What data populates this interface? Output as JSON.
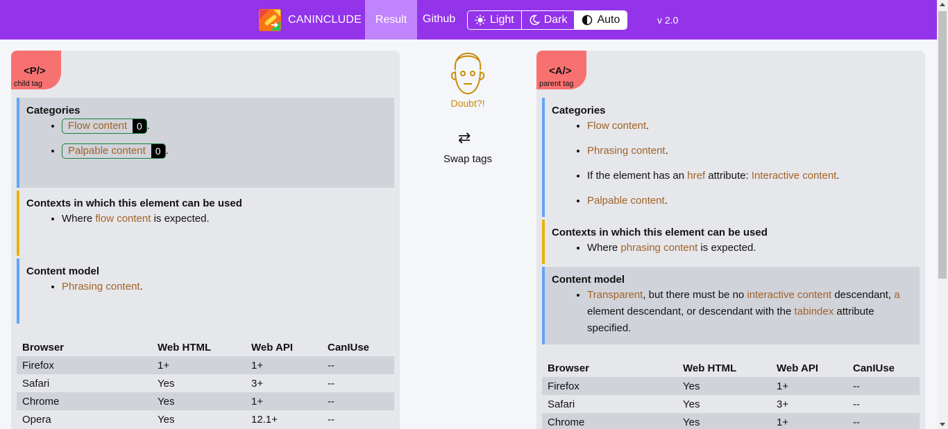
{
  "nav": {
    "brand": "CANINCLUDE",
    "result": "Result",
    "github": "Github",
    "theme": {
      "light": "Light",
      "dark": "Dark",
      "auto": "Auto",
      "active": "auto"
    },
    "version": "v 2.0",
    "colors": {
      "bar": "#9333ea",
      "active_tab": "#c084fc"
    }
  },
  "center": {
    "doubt": "Doubt?!",
    "swap": "Swap tags",
    "swap_icon": "⇄"
  },
  "left": {
    "tag": "<P/>",
    "role": "child tag",
    "categories_title": "Categories",
    "categories": [
      {
        "label": "Flow content",
        "count": "0"
      },
      {
        "label": "Palpable content",
        "count": "0"
      }
    ],
    "contexts_title": "Contexts in which this element can be used",
    "contexts": {
      "pre": "Where ",
      "link": "flow content",
      "post": " is expected."
    },
    "content_model_title": "Content model",
    "content_model": {
      "link": "Phrasing content",
      "post": "."
    },
    "table": {
      "headers": [
        "Browser",
        "Web HTML",
        "Web API",
        "CanIUse"
      ],
      "rows": [
        [
          "Firefox",
          "1+",
          "1+",
          "--"
        ],
        [
          "Safari",
          "Yes",
          "3+",
          "--"
        ],
        [
          "Chrome",
          "Yes",
          "1+",
          "--"
        ],
        [
          "Opera",
          "Yes",
          "12.1+",
          "--"
        ]
      ]
    }
  },
  "right": {
    "tag": "<A/>",
    "role": "parent tag",
    "categories_title": "Categories",
    "categories": {
      "c1": "Flow content",
      "c2": "Phrasing content",
      "c3_pre": "If the element has an ",
      "c3_attr": "href",
      "c3_mid": " attribute: ",
      "c3_link": "Interactive content",
      "c4": "Palpable content",
      "dot": "."
    },
    "contexts_title": "Contexts in which this element can be used",
    "contexts": {
      "pre": "Where ",
      "link": "phrasing content",
      "post": " is expected."
    },
    "content_model_title": "Content model",
    "content_model": {
      "l1": "Transparent",
      "t1": ", but there must be no ",
      "l2": "interactive content",
      "t2": " descendant, ",
      "l3": "a",
      "t3": " element descendant, or descendant with the ",
      "l4": "tabindex",
      "t4": " attribute specified."
    },
    "table": {
      "headers": [
        "Browser",
        "Web HTML",
        "Web API",
        "CanIUse"
      ],
      "rows": [
        [
          "Firefox",
          "Yes",
          "1+",
          "--"
        ],
        [
          "Safari",
          "Yes",
          "3+",
          "--"
        ],
        [
          "Chrome",
          "Yes",
          "1+",
          "--"
        ]
      ]
    }
  }
}
